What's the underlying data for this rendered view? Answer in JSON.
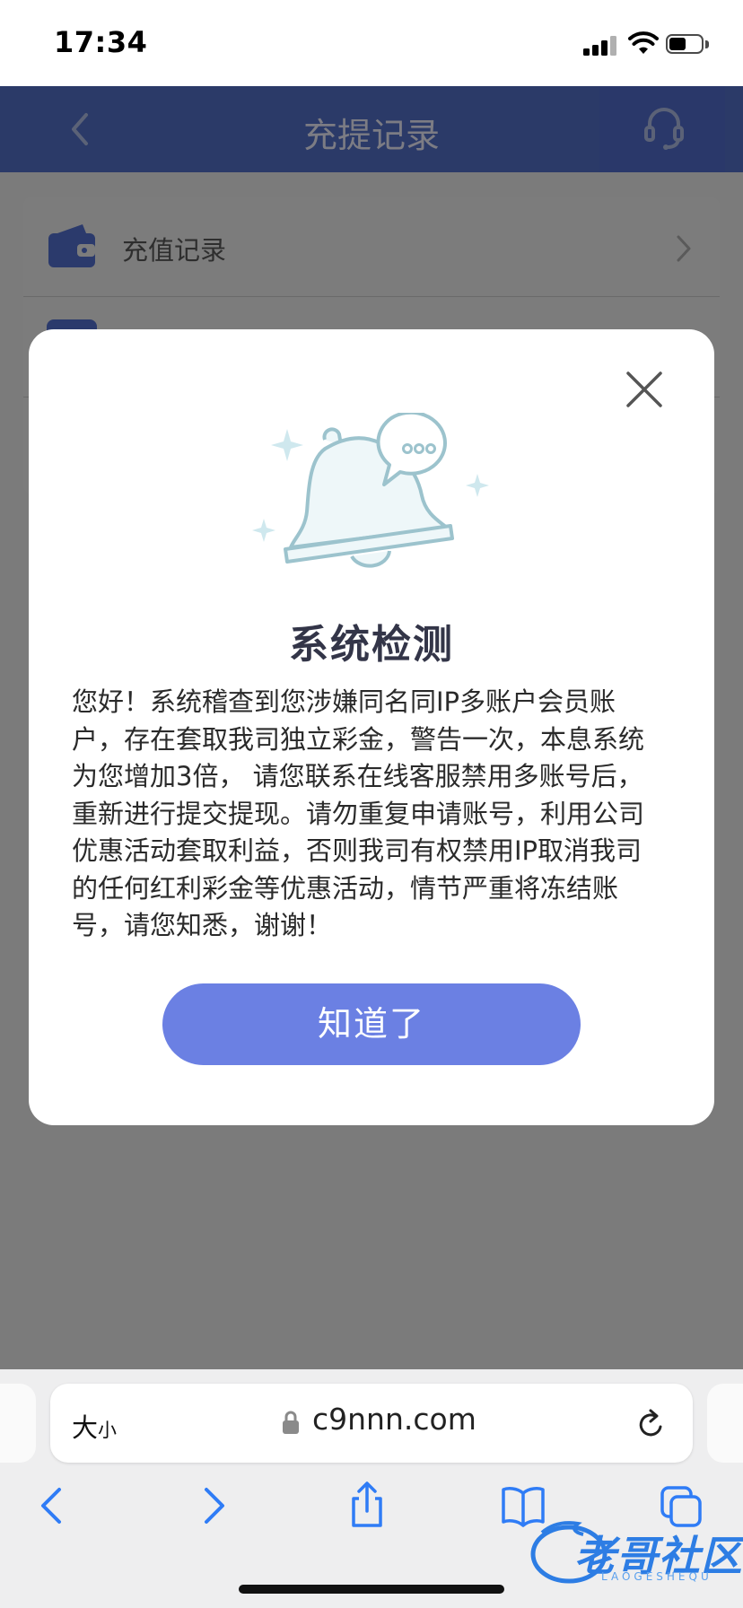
{
  "status_bar": {
    "time": "17:34"
  },
  "header": {
    "title": "充提记录"
  },
  "list": {
    "items": [
      {
        "label": "充值记录"
      }
    ]
  },
  "modal": {
    "title": "系统检测",
    "body": "您好！系统稽查到您涉嫌同名同IP多账户会员账户，存在套取我司独立彩金，警告一次，本息系统为您增加3倍， 请您联系在线客服禁用多账号后，重新进行提交提现。请勿重复申请账号，利用公司优惠活动套取利益，否则我司有权禁用IP取消我司的任何红利彩金等优惠活动，情节严重将冻结账号，请您知悉，谢谢！",
    "confirm_label": "知道了"
  },
  "browser": {
    "text_size_label_big": "大",
    "text_size_label_small": "小",
    "url": "c9nnn.com"
  },
  "watermark": {
    "text": "老哥社区",
    "subtext": "LAOGESHEQU"
  },
  "colors": {
    "header_bg": "#2b3a68",
    "accent": "#6b80e3",
    "overlay": "#7b7b7b"
  }
}
